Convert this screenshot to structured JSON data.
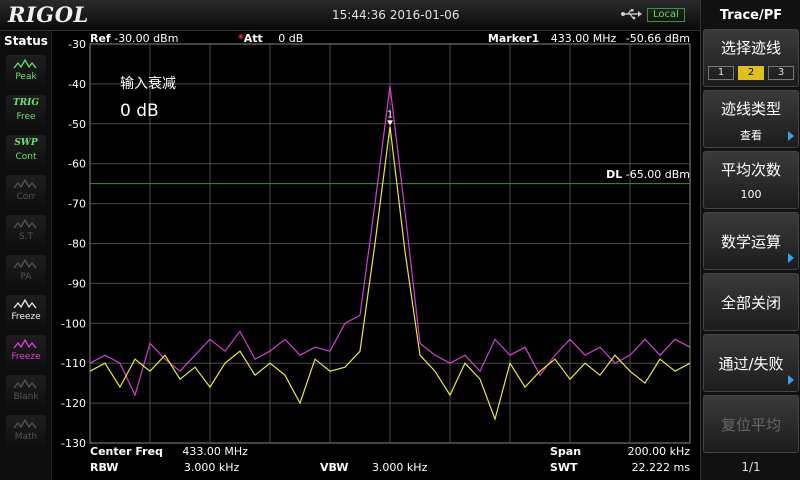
{
  "app": {
    "logo": "RIGOL",
    "datetime": "15:44:36 2016-01-06",
    "local_label": "Local",
    "status_title": "Status"
  },
  "status_buttons": [
    {
      "key": "peak",
      "label": "Peak",
      "state": "green"
    },
    {
      "key": "trig",
      "top": "TRIG",
      "label": "Free",
      "state": "green"
    },
    {
      "key": "swp",
      "top": "SWP",
      "label": "Cont",
      "state": "green"
    },
    {
      "key": "corr",
      "label": "Corr",
      "state": "dim"
    },
    {
      "key": "st",
      "label": "S.T",
      "state": "dim"
    },
    {
      "key": "pa",
      "label": "PA",
      "state": "dim"
    },
    {
      "key": "freeze1",
      "label": "Freeze",
      "state": "white"
    },
    {
      "key": "freeze2",
      "label": "Freeze",
      "state": "magenta"
    },
    {
      "key": "blank",
      "label": "Blank",
      "state": "dim"
    },
    {
      "key": "math",
      "label": "Math",
      "state": "dim"
    }
  ],
  "plot_header": {
    "ref_label": "Ref",
    "ref_value": "-30.00 dBm",
    "att_label": "Att",
    "att_value": "0 dB",
    "marker_label": "Marker1",
    "marker_freq": "433.00 MHz",
    "marker_amp": "-50.66 dBm"
  },
  "annotation": {
    "title": "输入衰减",
    "value": "0 dB"
  },
  "display_line": {
    "label": "DL",
    "value": "-65.00 dBm",
    "level": -65,
    "color": "#3c8f3c"
  },
  "marker": {
    "number": "1",
    "freq_mhz": 433.0,
    "amp_dbm": -50.66
  },
  "plot_footer": {
    "center_label": "Center Freq",
    "center_value": "433.00 MHz",
    "span_label": "Span",
    "span_value": "200.00 kHz",
    "rbw_label": "RBW",
    "rbw_value": "3.000 kHz",
    "vbw_label": "VBW",
    "vbw_value": "3.000 kHz",
    "swt_label": "SWT",
    "swt_value": "22.222 ms"
  },
  "chart_data": {
    "type": "line",
    "title": "",
    "xlabel": "",
    "ylabel": "",
    "xlim": [
      432.9,
      433.1
    ],
    "ylim": [
      -130,
      -30
    ],
    "y_ticks": [
      "-30",
      "-40",
      "-50",
      "-60",
      "-70",
      "-80",
      "-90",
      "-100",
      "-110",
      "-120",
      "-130"
    ],
    "grid": true,
    "x": [
      432.9,
      432.905,
      432.91,
      432.915,
      432.92,
      432.925,
      432.93,
      432.935,
      432.94,
      432.945,
      432.95,
      432.955,
      432.96,
      432.965,
      432.97,
      432.975,
      432.98,
      432.985,
      432.99,
      432.995,
      433.0,
      433.005,
      433.01,
      433.015,
      433.02,
      433.025,
      433.03,
      433.035,
      433.04,
      433.045,
      433.05,
      433.055,
      433.06,
      433.065,
      433.07,
      433.075,
      433.08,
      433.085,
      433.09,
      433.095,
      433.1
    ],
    "series": [
      {
        "color": "#d040d0",
        "values": [
          -110,
          -108,
          -110,
          -118,
          -105,
          -109,
          -112,
          -108,
          -104,
          -107,
          -102,
          -109,
          -107,
          -104,
          -108,
          -106,
          -107,
          -100,
          -98,
          -70,
          -40.5,
          -72,
          -105,
          -108,
          -110,
          -108,
          -112,
          -104,
          -108,
          -106,
          -113,
          -108,
          -104,
          -108,
          -106,
          -110,
          -108,
          -104,
          -108,
          -104,
          -106
        ]
      },
      {
        "color": "#e8e840",
        "values": [
          -112,
          -110,
          -116,
          -109,
          -112,
          -108,
          -114,
          -111,
          -116,
          -110,
          -107,
          -113,
          -110,
          -113,
          -120,
          -109,
          -112,
          -111,
          -107,
          -80,
          -50.66,
          -82,
          -108,
          -112,
          -118,
          -110,
          -114,
          -124,
          -110,
          -116,
          -112,
          -109,
          -114,
          -110,
          -113,
          -108,
          -112,
          -115,
          -109,
          -112,
          -110
        ]
      }
    ]
  },
  "menu": {
    "title": "Trace/PF",
    "items": [
      {
        "key": "select-trace",
        "label": "选择迹线",
        "kind": "segmented",
        "segments": [
          "1",
          "2",
          "3"
        ],
        "active": 1
      },
      {
        "key": "trace-type",
        "label": "迹线类型",
        "sub": "查看",
        "arrow": true
      },
      {
        "key": "avg-count",
        "label": "平均次数",
        "sub": "100",
        "arrow": false
      },
      {
        "key": "math-op",
        "label": "数学运算",
        "sub": "",
        "arrow": true
      },
      {
        "key": "all-off",
        "label": "全部关闭",
        "sub": "",
        "arrow": false
      },
      {
        "key": "pass-fail",
        "label": "通过/失败",
        "sub": "",
        "arrow": true
      },
      {
        "key": "reset-avg",
        "label": "复位平均",
        "sub": "",
        "arrow": false,
        "disabled": true
      }
    ],
    "page": "1/1"
  }
}
